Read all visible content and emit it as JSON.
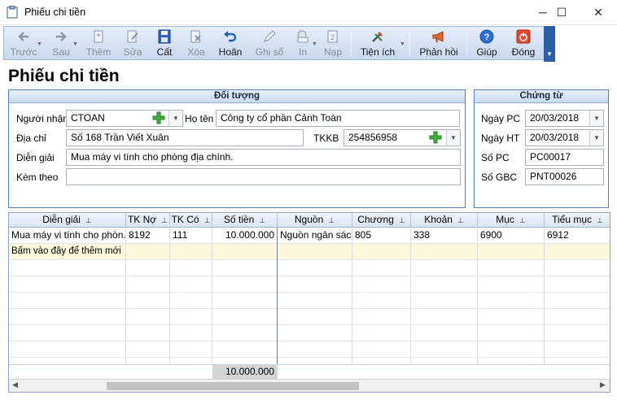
{
  "window": {
    "title": "Phiếu chi tiền",
    "minimize_glyph": "─",
    "maximize_glyph": "☐",
    "close_glyph": "✕"
  },
  "toolbar": {
    "items": [
      {
        "label": "Trước",
        "icon": "arrow-left-icon",
        "enabled": false
      },
      {
        "label": "Sau",
        "icon": "arrow-right-icon",
        "enabled": false
      },
      {
        "label": "Thêm",
        "icon": "add-document-icon",
        "enabled": false
      },
      {
        "label": "Sửa",
        "icon": "edit-document-icon",
        "enabled": false
      },
      {
        "label": "Cất",
        "icon": "floppy-save-icon",
        "enabled": true
      },
      {
        "label": "Xóa",
        "icon": "delete-document-icon",
        "enabled": false
      },
      {
        "label": "Hoãn",
        "icon": "undo-icon",
        "enabled": true
      },
      {
        "label": "Ghi sổ",
        "icon": "pencil-icon",
        "enabled": false
      },
      {
        "label": "In",
        "icon": "printer-icon",
        "enabled": false
      },
      {
        "label": "Nạp",
        "icon": "refresh-icon",
        "enabled": false
      },
      {
        "label": "Tiện ích",
        "icon": "tools-icon",
        "enabled": true
      },
      {
        "label": "Phản hồi",
        "icon": "megaphone-icon",
        "enabled": true
      },
      {
        "label": "Giúp",
        "icon": "help-icon",
        "enabled": true
      },
      {
        "label": "Đóng",
        "icon": "power-icon",
        "enabled": true
      }
    ]
  },
  "page_title": "Phiếu chi tiền",
  "doituong": {
    "heading": "Đối tượng",
    "nguoi_nhan_label": "Người nhận",
    "nguoi_nhan_value": "CTOAN",
    "ho_ten_label": "Họ tên",
    "ho_ten_value": "Công ty cổ phần Cảnh Toàn",
    "dia_chi_label": "Địa chỉ",
    "dia_chi_value": "Số 168 Trần Viết Xuân",
    "tkkb_label": "TKKB",
    "tkkb_value": "254856958",
    "dien_giai_label": "Diễn giải",
    "dien_giai_value": "Mua máy vi tính cho phòng địa chính.",
    "kem_theo_label": "Kèm theo",
    "kem_theo_value": ""
  },
  "chungtu": {
    "heading": "Chứng từ",
    "ngay_pc_label": "Ngày PC",
    "ngay_pc_value": "20/03/2018",
    "ngay_ht_label": "Ngày HT",
    "ngay_ht_value": "20/03/2018",
    "so_pc_label": "Số PC",
    "so_pc_value": "PC00017",
    "so_gbc_label": "Số GBC",
    "so_gbc_value": "PNT00026"
  },
  "grid": {
    "columns": [
      "Diễn giải",
      "TK Nợ",
      "TK Có",
      "Số tiền",
      "Nguồn",
      "Chương",
      "Khoản",
      "Mục",
      "Tiểu mục"
    ],
    "pin_glyph": "⊥",
    "row": [
      "Mua máy vi tính cho phòn...",
      "8192",
      "111",
      "10.000.000",
      "Nguồn ngân sác...",
      "805",
      "338",
      "6900",
      "6912"
    ],
    "new_row_text": "Bấm vào đây để thêm mới",
    "total": "10.000.000"
  }
}
